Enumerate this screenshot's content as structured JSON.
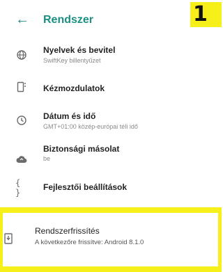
{
  "header": {
    "back_icon": "arrow-left-icon",
    "title": "Rendszer",
    "badge": "1"
  },
  "items": [
    {
      "label": "Nyelvek és bevitel",
      "sub": "SwiftKey billentyűzet",
      "icon": "globe-icon"
    },
    {
      "label": "Kézmozdulatok",
      "sub": "",
      "icon": "gesture-icon"
    },
    {
      "label": "Dátum és idő",
      "sub": "GMT+01:00 közép-európai téli idő",
      "icon": "clock-icon"
    },
    {
      "label": "Biztonsági másolat",
      "sub": "be",
      "icon": "cloud-upload-icon"
    },
    {
      "label": "Fejlesztői beállítások",
      "sub": "",
      "icon": "code-braces-icon"
    }
  ],
  "update": {
    "label": "Rendszerfrissítés",
    "sub": "A következőre frissítve: Android 8.1.0",
    "icon": "system-update-icon"
  },
  "colors": {
    "accent": "#1a8f82",
    "highlight": "#f6ef19"
  }
}
